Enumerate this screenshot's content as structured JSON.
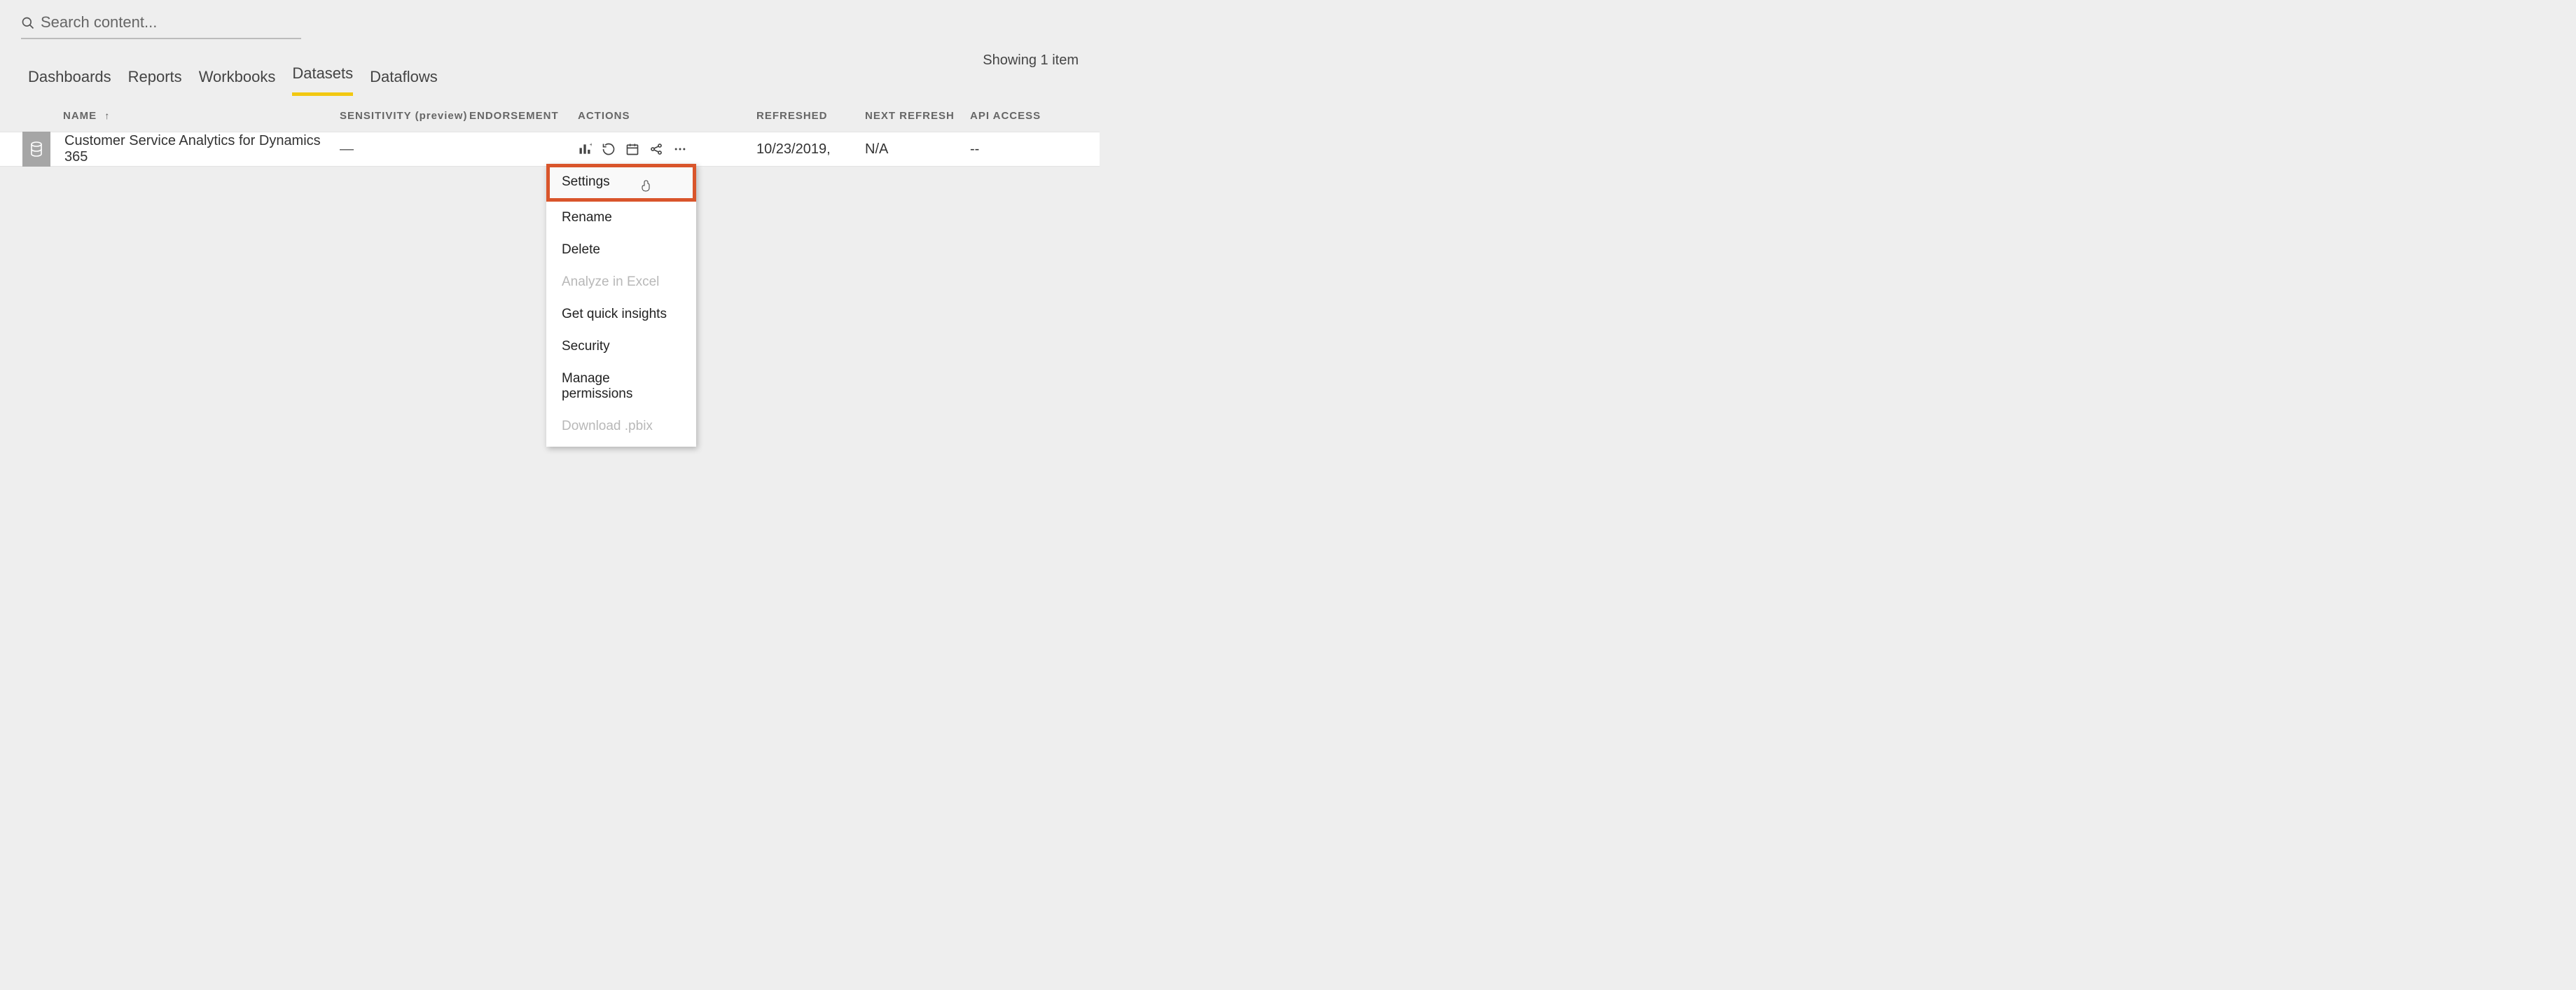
{
  "search": {
    "placeholder": "Search content..."
  },
  "item_count": "Showing 1 item",
  "tabs": [
    {
      "label": "Dashboards",
      "active": false
    },
    {
      "label": "Reports",
      "active": false
    },
    {
      "label": "Workbooks",
      "active": false
    },
    {
      "label": "Datasets",
      "active": true
    },
    {
      "label": "Dataflows",
      "active": false
    }
  ],
  "columns": {
    "name": "NAME",
    "sensitivity": "SENSITIVITY (preview)",
    "endorsement": "ENDORSEMENT",
    "actions": "ACTIONS",
    "refreshed": "REFRESHED",
    "next_refresh": "NEXT REFRESH",
    "api_access": "API ACCESS"
  },
  "row": {
    "name": "Customer Service Analytics for Dynamics 365",
    "sensitivity": "—",
    "endorsement": "",
    "refreshed": "10/23/2019,",
    "next_refresh": "N/A",
    "api_access": "--"
  },
  "menu": {
    "settings": "Settings",
    "rename": "Rename",
    "delete": "Delete",
    "analyze": "Analyze in Excel",
    "insights": "Get quick insights",
    "security": "Security",
    "permissions": "Manage permissions",
    "download": "Download .pbix"
  }
}
